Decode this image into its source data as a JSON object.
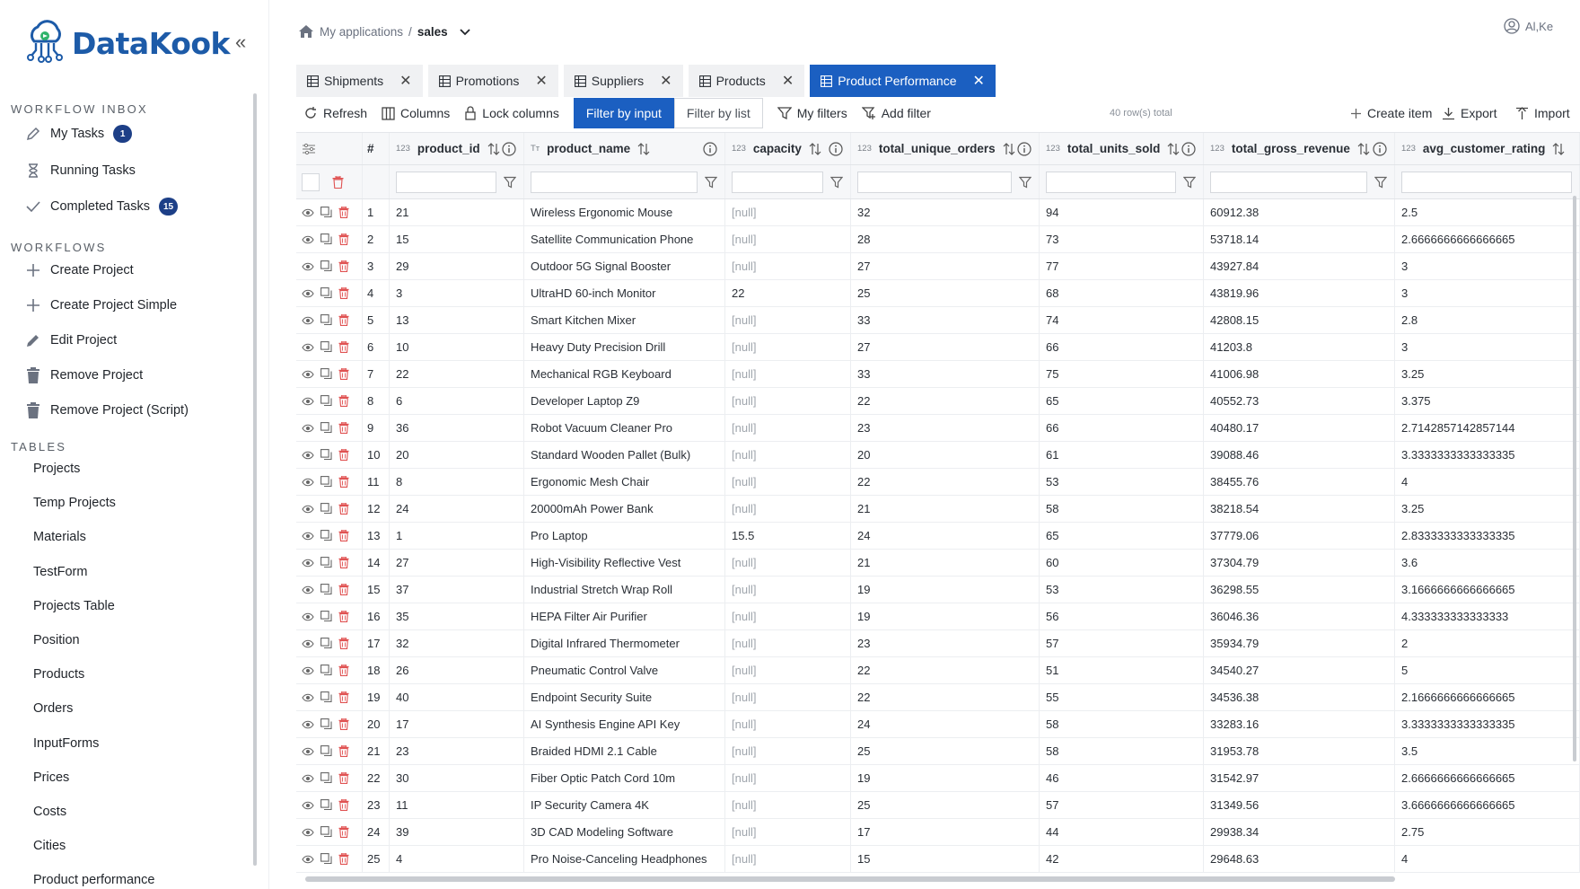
{
  "app": {
    "name": "DataKook"
  },
  "sidebar": {
    "inbox_title": "WORKFLOW INBOX",
    "inbox": [
      {
        "label": "My Tasks",
        "badge": "1",
        "icon": "pencil-icon"
      },
      {
        "label": "Running Tasks",
        "badge": "",
        "icon": "hourglass-icon"
      },
      {
        "label": "Completed Tasks",
        "badge": "15",
        "icon": "check-icon"
      }
    ],
    "workflows_title": "WORKFLOWS",
    "workflows": [
      {
        "label": "Create Project",
        "icon": "plus-icon"
      },
      {
        "label": "Create Project Simple",
        "icon": "plus-icon"
      },
      {
        "label": "Edit Project",
        "icon": "edit-icon"
      },
      {
        "label": "Remove Project",
        "icon": "trash-icon"
      },
      {
        "label": "Remove Project (Script)",
        "icon": "trash-icon"
      }
    ],
    "tables_title": "TABLES",
    "tables": [
      "Projects",
      "Temp Projects",
      "Materials",
      "TestForm",
      "Projects Table",
      "Position",
      "Products",
      "Orders",
      "InputForms",
      "Prices",
      "Costs",
      "Cities",
      "Product performance"
    ]
  },
  "breadcrumb": {
    "parent": "My applications",
    "separator": "/",
    "current": "sales"
  },
  "user": {
    "name": "Al,Ke"
  },
  "tabs": [
    {
      "label": "Shipments",
      "active": false
    },
    {
      "label": "Promotions",
      "active": false
    },
    {
      "label": "Suppliers",
      "active": false
    },
    {
      "label": "Products",
      "active": false
    },
    {
      "label": "Product Performance",
      "active": true
    }
  ],
  "toolbar": {
    "refresh": "Refresh",
    "columns": "Columns",
    "lock_columns": "Lock columns",
    "filter_by_input": "Filter by input",
    "filter_by_list": "Filter by list",
    "my_filters": "My filters",
    "add_filter": "Add filter",
    "rows_total": "40 row(s) total",
    "create_item": "Create item",
    "export": "Export",
    "import": "Import"
  },
  "grid": {
    "columns": [
      {
        "key": "no",
        "label": "#",
        "type": ""
      },
      {
        "key": "product_id",
        "label": "product_id",
        "type": "123"
      },
      {
        "key": "product_name",
        "label": "product_name",
        "type": "Tт"
      },
      {
        "key": "capacity",
        "label": "capacity",
        "type": "123"
      },
      {
        "key": "total_unique_orders",
        "label": "total_unique_orders",
        "type": "123"
      },
      {
        "key": "total_units_sold",
        "label": "total_units_sold",
        "type": "123"
      },
      {
        "key": "total_gross_revenue",
        "label": "total_gross_revenue",
        "type": "123"
      },
      {
        "key": "avg_customer_rating",
        "label": "avg_customer_rating",
        "type": "123"
      }
    ],
    "rows": [
      [
        "1",
        "21",
        "Wireless Ergonomic Mouse",
        "[null]",
        "32",
        "94",
        "60912.38",
        "2.5"
      ],
      [
        "2",
        "15",
        "Satellite Communication Phone",
        "[null]",
        "28",
        "73",
        "53718.14",
        "2.6666666666666665"
      ],
      [
        "3",
        "29",
        "Outdoor 5G Signal Booster",
        "[null]",
        "27",
        "77",
        "43927.84",
        "3"
      ],
      [
        "4",
        "3",
        "UltraHD 60-inch Monitor",
        "22",
        "25",
        "68",
        "43819.96",
        "3"
      ],
      [
        "5",
        "13",
        "Smart Kitchen Mixer",
        "[null]",
        "33",
        "74",
        "42808.15",
        "2.8"
      ],
      [
        "6",
        "10",
        "Heavy Duty Precision Drill",
        "[null]",
        "27",
        "66",
        "41203.8",
        "3"
      ],
      [
        "7",
        "22",
        "Mechanical RGB Keyboard",
        "[null]",
        "33",
        "75",
        "41006.98",
        "3.25"
      ],
      [
        "8",
        "6",
        "Developer Laptop Z9",
        "[null]",
        "22",
        "65",
        "40552.73",
        "3.375"
      ],
      [
        "9",
        "36",
        "Robot Vacuum Cleaner Pro",
        "[null]",
        "23",
        "66",
        "40480.17",
        "2.7142857142857144"
      ],
      [
        "10",
        "20",
        "Standard Wooden Pallet (Bulk)",
        "[null]",
        "20",
        "61",
        "39088.46",
        "3.3333333333333335"
      ],
      [
        "11",
        "8",
        "Ergonomic Mesh Chair",
        "[null]",
        "22",
        "53",
        "38455.76",
        "4"
      ],
      [
        "12",
        "24",
        "20000mAh Power Bank",
        "[null]",
        "21",
        "58",
        "38218.54",
        "3.25"
      ],
      [
        "13",
        "1",
        "Pro Laptop",
        "15.5",
        "24",
        "65",
        "37779.06",
        "2.8333333333333335"
      ],
      [
        "14",
        "27",
        "High-Visibility Reflective Vest",
        "[null]",
        "21",
        "60",
        "37304.79",
        "3.6"
      ],
      [
        "15",
        "37",
        "Industrial Stretch Wrap Roll",
        "[null]",
        "19",
        "53",
        "36298.55",
        "3.1666666666666665"
      ],
      [
        "16",
        "35",
        "HEPA Filter Air Purifier",
        "[null]",
        "19",
        "56",
        "36046.36",
        "4.333333333333333"
      ],
      [
        "17",
        "32",
        "Digital Infrared Thermometer",
        "[null]",
        "23",
        "57",
        "35934.79",
        "2"
      ],
      [
        "18",
        "26",
        "Pneumatic Control Valve",
        "[null]",
        "22",
        "51",
        "34540.27",
        "5"
      ],
      [
        "19",
        "40",
        "Endpoint Security Suite",
        "[null]",
        "22",
        "55",
        "34536.38",
        "2.1666666666666665"
      ],
      [
        "20",
        "17",
        "AI Synthesis Engine API Key",
        "[null]",
        "24",
        "58",
        "33283.16",
        "3.3333333333333335"
      ],
      [
        "21",
        "23",
        "Braided HDMI 2.1 Cable",
        "[null]",
        "25",
        "58",
        "31953.78",
        "3.5"
      ],
      [
        "22",
        "30",
        "Fiber Optic Patch Cord 10m",
        "[null]",
        "19",
        "46",
        "31542.97",
        "2.6666666666666665"
      ],
      [
        "23",
        "11",
        "IP Security Camera 4K",
        "[null]",
        "25",
        "57",
        "31349.56",
        "3.6666666666666665"
      ],
      [
        "24",
        "39",
        "3D CAD Modeling Software",
        "[null]",
        "17",
        "44",
        "29938.34",
        "2.75"
      ],
      [
        "25",
        "4",
        "Pro Noise-Canceling Headphones",
        "[null]",
        "15",
        "42",
        "29648.63",
        "4"
      ]
    ]
  },
  "colors": {
    "brand": "#1d5ba8",
    "accent": "#1b5fc1",
    "badge": "#1d3f87",
    "delete": "#e05252"
  }
}
